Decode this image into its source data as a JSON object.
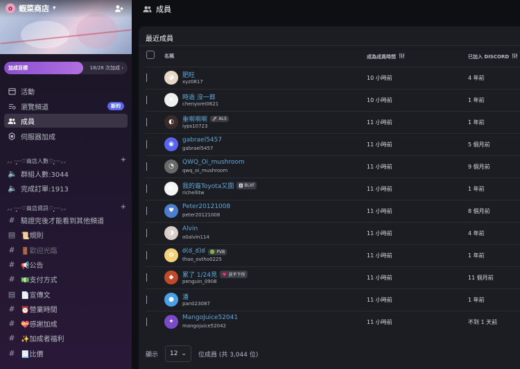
{
  "server": {
    "name": "蝦菜商店",
    "logo_icon": "server-logo-icon"
  },
  "goal": {
    "label": "加成目標",
    "count": "18/28 次加成",
    "progress": 0.643
  },
  "nav": [
    {
      "label": "活動",
      "icon": "calendar-icon"
    },
    {
      "label": "瀏覽頻道",
      "icon": "browse-channels-icon",
      "badge": "新的"
    },
    {
      "label": "成員",
      "icon": "members-icon"
    },
    {
      "label": "伺服器加成",
      "icon": "boost-icon"
    }
  ],
  "categories": {
    "stats": "⸝⸝ ·‧̩̥̩̥·‧♡商店人數♡‧̩̥̩̥·‧·⸝⸝",
    "info": "⸝⸝ ·‧̩̥̩̥·‧♡商店資訊♡‧̩̥̩̥·‧·⸝⸝"
  },
  "stats_channels": [
    {
      "label": "群組人數:3044"
    },
    {
      "label": "完成訂單:1913"
    }
  ],
  "info_channels": [
    {
      "prefix": "#",
      "label": "驗證完後才能看到其他頻道",
      "muted": false
    },
    {
      "prefix": "▤",
      "label": "📜規則",
      "muted": false
    },
    {
      "prefix": "#",
      "label": "🚪歡迎光臨",
      "muted": true
    },
    {
      "prefix": "#",
      "label": "📢公告",
      "muted": false
    },
    {
      "prefix": "#",
      "label": "💵支付方式",
      "muted": false
    },
    {
      "prefix": "▤",
      "label": "📄宣傳文",
      "muted": false
    },
    {
      "prefix": "#",
      "label": "⏰營業時間",
      "muted": false
    },
    {
      "prefix": "#",
      "label": "💝感謝加成",
      "muted": false
    },
    {
      "prefix": "#",
      "label": "✨加成者福利",
      "muted": false
    },
    {
      "prefix": "#",
      "label": "📃比價",
      "muted": false
    }
  ],
  "header": {
    "title": "成員"
  },
  "panel": {
    "title": "最近成員",
    "columns": {
      "name": "名稱",
      "since": "成為成員時間",
      "joined": "已加入 DISCORD"
    }
  },
  "members": [
    {
      "name": "肥旺",
      "handle": "xyz0817",
      "since": "10 小時前",
      "joined": "4 年前",
      "avatar_color": "#e8d8c8",
      "avatar_glyph": "◕",
      "tag": ""
    },
    {
      "name": "時過 沒一郎",
      "handle": "chenyorei0621",
      "since": "10 小時前",
      "joined": "1 年前",
      "avatar_color": "#f0f0f0",
      "avatar_glyph": "♠",
      "tag": ""
    },
    {
      "name": "重啊啊啊",
      "handle": "iyps10723",
      "since": "11 小時前",
      "joined": "1 年前",
      "avatar_color": "#3a2a2a",
      "avatar_glyph": "◐",
      "tag": "ALS",
      "tag_icon": "🚀"
    },
    {
      "name": "gabrael5457",
      "handle": "gabrael5457",
      "since": "11 小時前",
      "joined": "5 個月前",
      "avatar_color": "#5865f2",
      "avatar_glyph": "◉",
      "tag": ""
    },
    {
      "name": "QWQ_Oi_mushroom",
      "handle": "qwq_oi_mushroom",
      "since": "11 小時前",
      "joined": "9 個月前",
      "avatar_color": "#6a6a6a",
      "avatar_glyph": "◔",
      "tag": ""
    },
    {
      "name": "我的龜Toyota又圍",
      "handle": "richellitw",
      "since": "11 小時前",
      "joined": "1 年前",
      "avatar_color": "#f5f5f5",
      "avatar_glyph": "☻",
      "tag": "BLXF",
      "tag_icon": "🅱"
    },
    {
      "name": "Peter20121008",
      "handle": "peter20121008",
      "since": "11 小時前",
      "joined": "8 個月前",
      "avatar_color": "#4a7fd0",
      "avatar_glyph": "♥",
      "tag": ""
    },
    {
      "name": "Alvin",
      "handle": "o0alvin114",
      "since": "11 小時前",
      "joined": "4 年前",
      "avatar_color": "#d8d0c8",
      "avatar_glyph": "◑",
      "tag": ""
    },
    {
      "name": "ఠ(ఠ_ఠ)ఠ",
      "handle": "thao_ovtho0225",
      "since": "11 小時前",
      "joined": "1 年前",
      "avatar_color": "#f4d27a",
      "avatar_glyph": "✿",
      "tag": "PVB",
      "tag_icon": "🟢"
    },
    {
      "name": "累了 1/24見",
      "handle": "penguin_0908",
      "since": "11 小時前",
      "joined": "11 個月前",
      "avatar_color": "#c04a2a",
      "avatar_glyph": "◆",
      "tag": "放不下你",
      "tag_icon": "💗"
    },
    {
      "name": "潘",
      "handle": "pan023087",
      "since": "11 小時前",
      "joined": "1 年前",
      "avatar_color": "#4aa0e8",
      "avatar_glyph": "●",
      "tag": ""
    },
    {
      "name": "MangoJuice52041",
      "handle": "mangojuice52042",
      "since": "11 小時前",
      "joined": "不到 1 天前",
      "avatar_color": "#7a4ac8",
      "avatar_glyph": "✦",
      "tag": ""
    }
  ],
  "footer": {
    "show_label": "顯示",
    "page_size": "12",
    "count_text": "位成員 (共 3,044 位)"
  }
}
